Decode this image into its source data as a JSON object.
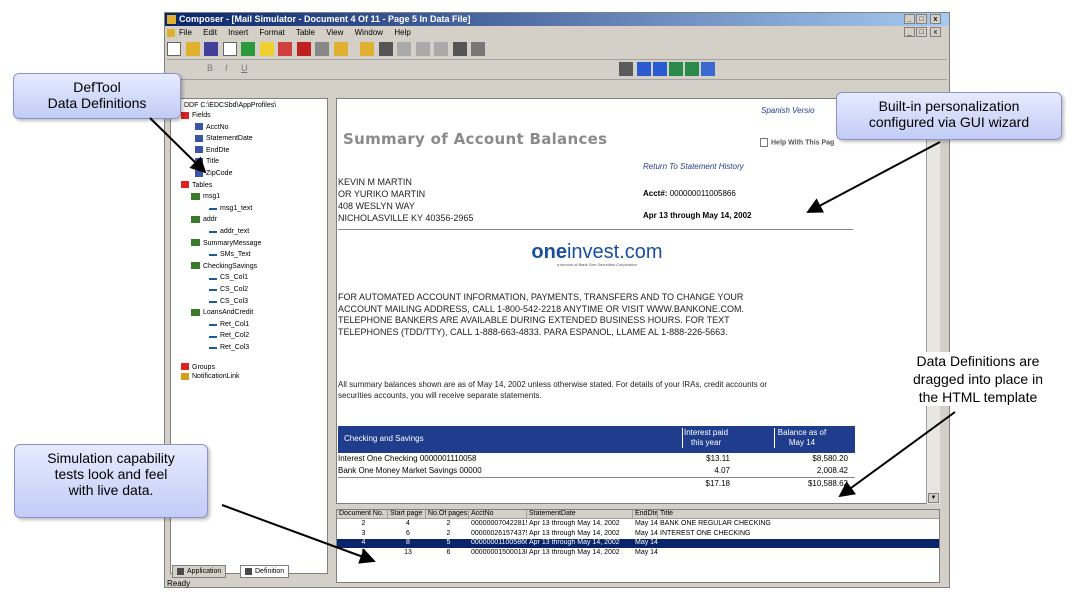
{
  "window": {
    "title": "Composer - [Mail Simulator - Document 4 Of 11 - Page 5 In Data File]",
    "caption_buttons": [
      "_",
      "□",
      "x"
    ],
    "menu": [
      "File",
      "Edit",
      "Insert",
      "Format",
      "Table",
      "View",
      "Window",
      "Help"
    ]
  },
  "format_toolbar": {
    "items": [
      "B",
      "I",
      "U"
    ]
  },
  "tree": {
    "root": "DDF C:\\EDCSbd\\AppProfiles\\",
    "nodes": [
      {
        "label": "Fields",
        "icon": "folder-icon"
      },
      {
        "label": "AcctNo",
        "icon": "field-icon"
      },
      {
        "label": "StatementDate",
        "icon": "field-icon"
      },
      {
        "label": "EndDte",
        "icon": "field-icon"
      },
      {
        "label": "Title",
        "icon": "field-icon"
      },
      {
        "label": "ZipCode",
        "icon": "field-icon"
      },
      {
        "label": "Tables",
        "icon": "folder-icon"
      },
      {
        "label": "msg1",
        "icon": "table-icon"
      },
      {
        "label": "msg1_text",
        "icon": "column-icon"
      },
      {
        "label": "addr",
        "icon": "table-icon"
      },
      {
        "label": "addr_text",
        "icon": "column-icon"
      },
      {
        "label": "SummaryMessage",
        "icon": "table-icon"
      },
      {
        "label": "SMs_Text",
        "icon": "column-icon"
      },
      {
        "label": "CheckingSavings",
        "icon": "table-icon"
      },
      {
        "label": "CS_Col1",
        "icon": "column-icon"
      },
      {
        "label": "CS_Col2",
        "icon": "column-icon"
      },
      {
        "label": "CS_Col3",
        "icon": "column-icon"
      },
      {
        "label": "LoansAndCredit",
        "icon": "table-icon"
      },
      {
        "label": "Ret_Col1",
        "icon": "column-icon"
      },
      {
        "label": "Ret_Col2",
        "icon": "column-icon"
      },
      {
        "label": "Ret_Col3",
        "icon": "column-icon"
      },
      {
        "label": "Groups",
        "icon": "folder-icon"
      },
      {
        "label": "NotificationLink",
        "icon": "link-icon"
      }
    ],
    "tabs": [
      "Application",
      "Definition"
    ]
  },
  "document": {
    "spanish_link": "Spanish Versio",
    "title": "Summary of Account Balances",
    "help_link": "Help With This Pag",
    "return_link": "Return To Statement History",
    "address": [
      "KEVIN M MARTIN",
      "OR YURIKO MARTIN",
      "408 WESLYN WAY",
      "NICHOLASVILLE KY 40356-2965"
    ],
    "acct_label": "Acct#:",
    "acct_value": "000000011005866",
    "period": "Apr 13 through May 14, 2002",
    "logo_one": "one",
    "logo_rest": "invest.com",
    "logo_sub": "a service of Bank One Securities Corporation",
    "notice": "FOR AUTOMATED ACCOUNT INFORMATION, PAYMENTS, TRANSFERS AND TO CHANGE YOUR ACCOUNT MAILING ADDRESS, CALL 1-800-542-2218 ANYTIME OR VISIT WWW.BANKONE.COM. TELEPHONE BANKERS ARE AVAILABLE DURING EXTENDED BUSINESS HOURS. FOR TEXT TELEPHONES (TDD/TTY), CALL 1-888-663-4833. PARA ESPANOL, LLAME AL 1-888-226-5663.",
    "summary": "All summary balances shown are as of May 14, 2002 unless otherwise stated. For details of your IRAs, credit accounts or securities accounts, you will receive separate statements.",
    "table_header": [
      "Checking and Savings",
      "Interest paid this year",
      "Balance as of May 14"
    ],
    "rows": [
      [
        "Interest One Checking 0000001110058",
        "$13.11",
        "$8,580.20"
      ],
      [
        "Bank One Money Market Savings 00000",
        "4.07",
        "2,008.42"
      ],
      [
        "",
        "$17.18",
        "$10,588.62"
      ]
    ]
  },
  "grid": {
    "headers": [
      "Document No.",
      "Start page",
      "No.Of pages",
      "AcctNo",
      "StatementDate",
      "EndDte",
      "Title"
    ],
    "rows": [
      [
        "2",
        "4",
        "2",
        "000000070422815",
        "Apr 13 through May 14, 2002",
        "May 14",
        "BANK ONE REGULAR CHECKING"
      ],
      [
        "3",
        "6",
        "2",
        "000000261574379",
        "Apr 13 through May 14, 2002",
        "May 14",
        "INTEREST ONE CHECKING"
      ],
      [
        "4",
        "8",
        "5",
        "000000011005866",
        "Apr 13 through May 14, 2002",
        "May 14",
        ""
      ],
      [
        "5",
        "13",
        "6",
        "000000015000138",
        "Apr 13 through May 14, 2002",
        "May 14",
        ""
      ]
    ],
    "selected_row": 2
  },
  "status": {
    "text": "Ready"
  },
  "callouts": {
    "deftool_line1": "DefTool",
    "deftool_line2": "Data Definitions",
    "builtin_line1": "Built-in personalization",
    "builtin_line2": "configured via GUI wizard",
    "dragged_line1": "Data Definitions are",
    "dragged_line2": "dragged into place in",
    "dragged_line3": "the HTML template",
    "simulation_line1": "Simulation capability",
    "simulation_line2": "tests look and feel",
    "simulation_line3": "with live data."
  },
  "colors": {
    "title_bar": "#0a246a",
    "table_header": "#1f3d8c",
    "selected_row": "#0a246a",
    "callout_fill": "#c8d1f7",
    "logo_blue": "#1a4fa0"
  }
}
